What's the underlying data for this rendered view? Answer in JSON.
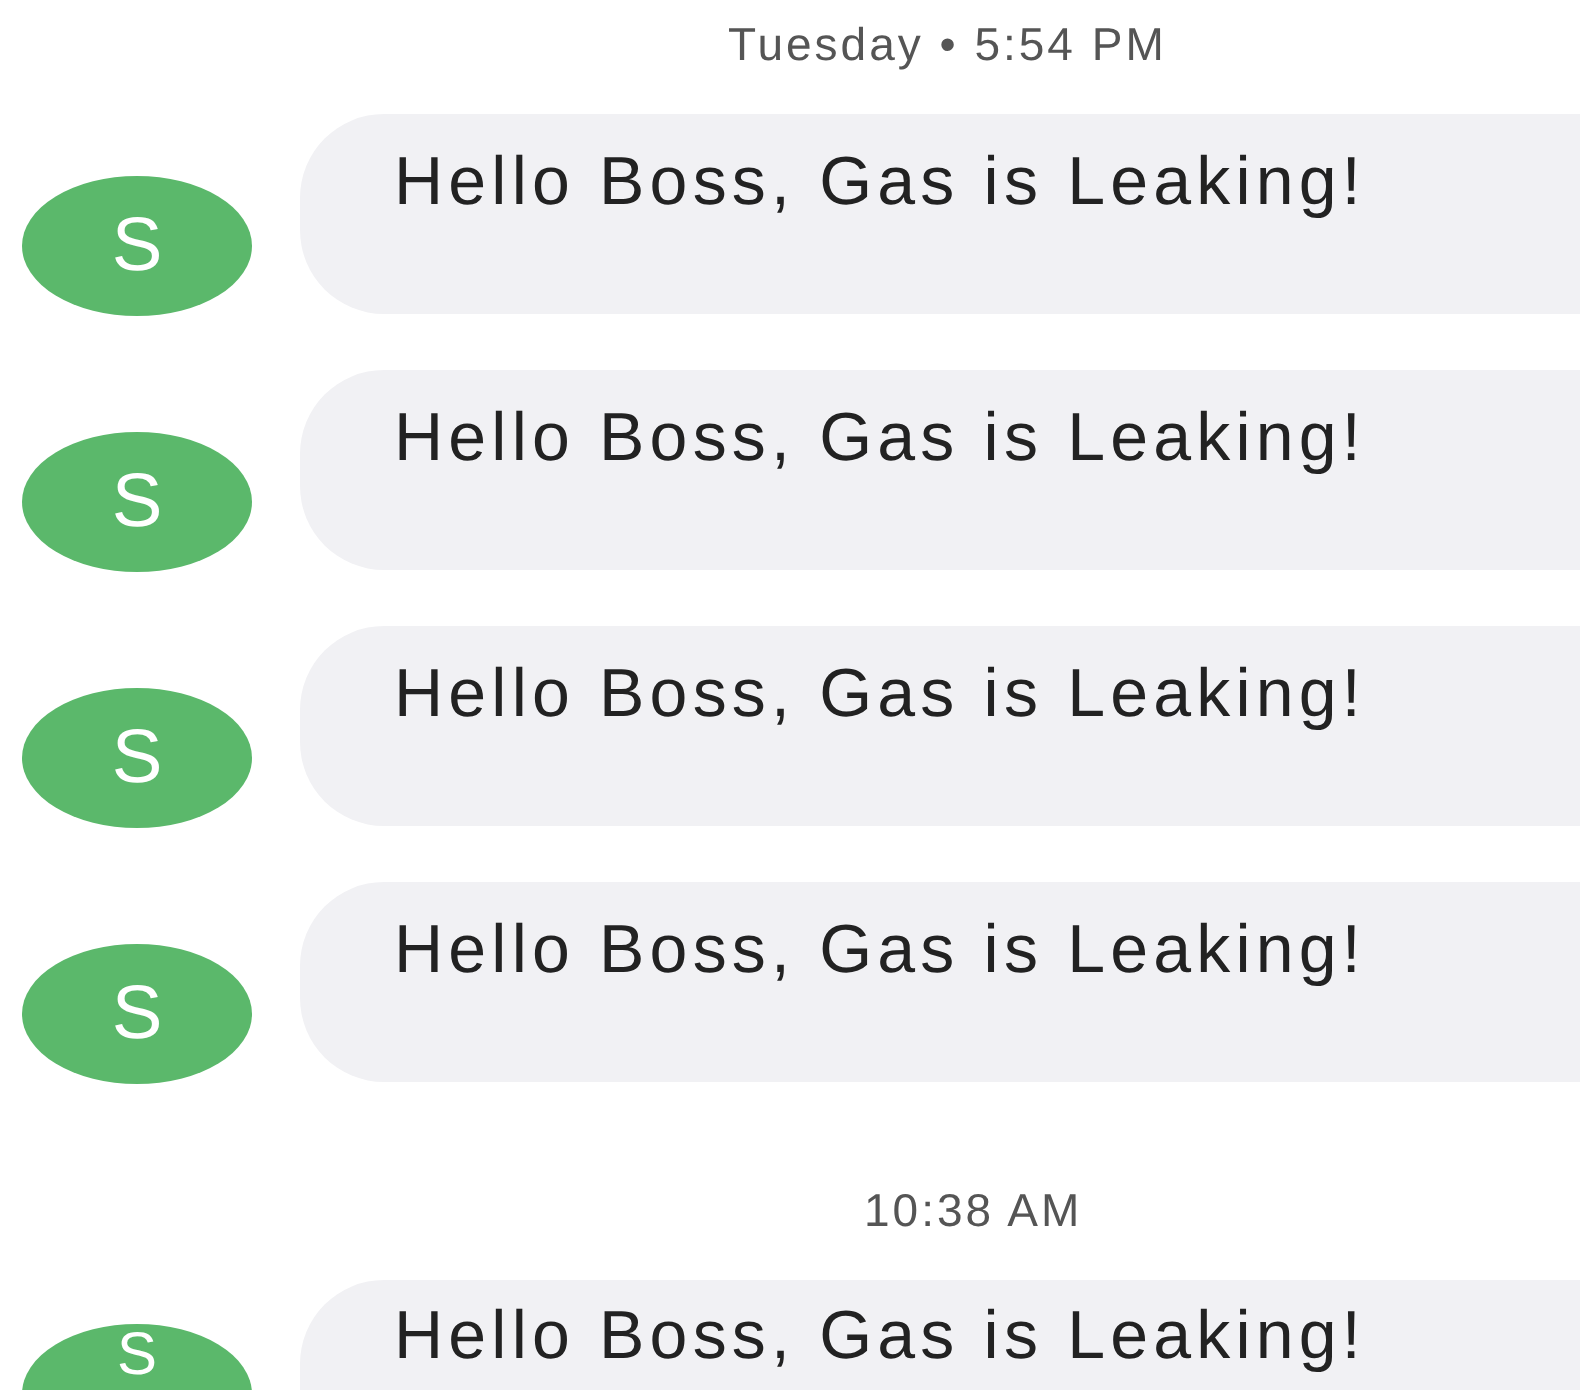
{
  "groups": [
    {
      "timestamp": "Tuesday • 5:54 PM",
      "messages": [
        {
          "avatar": "S",
          "text": "Hello Boss, Gas is Leaking!"
        },
        {
          "avatar": "S",
          "text": "Hello Boss, Gas is Leaking!"
        },
        {
          "avatar": "S",
          "text": "Hello Boss, Gas is Leaking!"
        },
        {
          "avatar": "S",
          "text": "Hello Boss, Gas is Leaking!"
        }
      ]
    },
    {
      "timestamp": "10:38 AM",
      "messages": [
        {
          "avatar": "S",
          "text": "Hello Boss, Gas is Leaking!"
        }
      ]
    }
  ]
}
